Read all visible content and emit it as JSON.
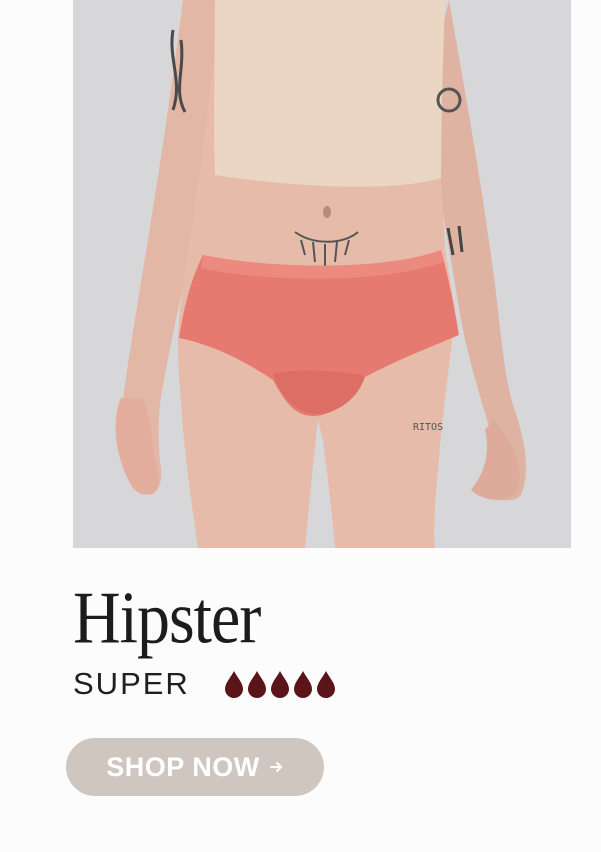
{
  "product": {
    "name": "Hipster",
    "absorbency_label": "SUPER",
    "absorbency_level": 5,
    "absorbency_max": 5
  },
  "cta": {
    "label": "SHOP NOW",
    "icon": "arrow-right-icon"
  },
  "colors": {
    "background": "#fdfcfc",
    "photo_background": "#d6d5d8",
    "product_color": "#e77a70",
    "drop_color": "#5b1519",
    "button_background": "#cfc6c0",
    "button_text": "#ffffff"
  }
}
